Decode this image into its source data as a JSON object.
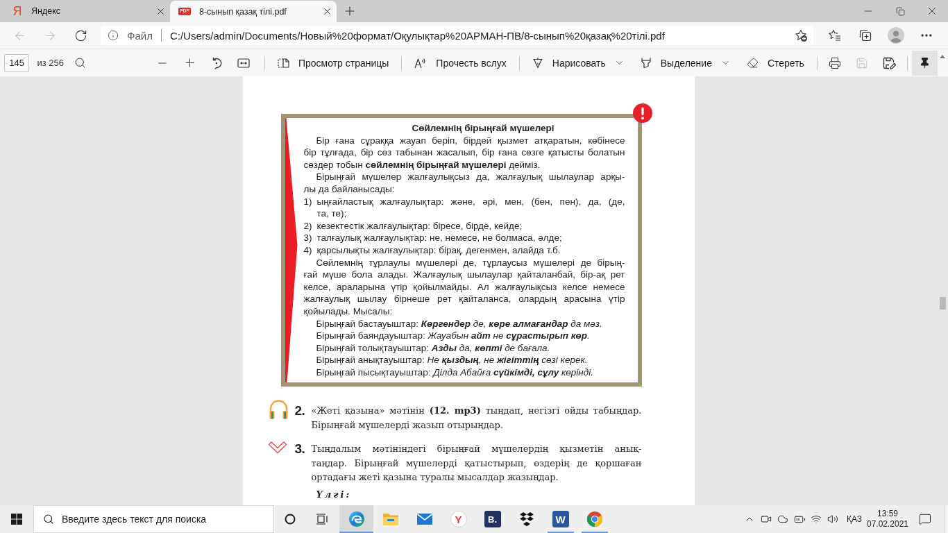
{
  "browser": {
    "tabs": [
      {
        "title": "Яндекс",
        "favicon": "Я",
        "kind": "site",
        "selected": false
      },
      {
        "title": "8-сынып қазақ тілі.pdf",
        "favicon": "PDF",
        "kind": "pdf",
        "selected": true
      }
    ],
    "nav_buttons": [
      {
        "kind": "back",
        "disabled": true
      },
      {
        "kind": "forward",
        "disabled": true
      },
      {
        "kind": "refresh",
        "disabled": false
      }
    ],
    "address_bar": {
      "scheme": "Файл",
      "url": "C:/Users/admin/Documents/Новый%20формат/Оқулықтар%20АРМАН-ПВ/8-сынып%20қазақ%20тілі.pdf"
    }
  },
  "pdf_toolbar": {
    "page": "145",
    "page_total": "из 256",
    "tools": [
      {
        "kind": "page-view",
        "label": "Просмотр страницы",
        "dropdown": false
      },
      {
        "kind": "read-aloud",
        "label": "Прочесть вслух",
        "dropdown": false
      },
      {
        "kind": "draw",
        "label": "Нарисовать",
        "dropdown": true
      },
      {
        "kind": "highlight",
        "label": "Выделение",
        "dropdown": true
      },
      {
        "kind": "erase",
        "label": "Стереть",
        "dropdown": false
      }
    ],
    "icon_buttons": [
      {
        "kind": "print",
        "disabled": false
      },
      {
        "kind": "save",
        "disabled": true
      },
      {
        "kind": "save-as",
        "disabled": false
      }
    ],
    "pinned": true
  },
  "document": {
    "info_box": {
      "title": "Сөйлемнің бірыңғай мүшелері",
      "blocks": [
        {
          "kind": "paragraph",
          "lines": [
            "Бір ғана сұраққа жауап беріп, бірдей қызмет атқаратын, көбінесе",
            "бір тұлғада, бір сөз табынан жасалып, бір ғана сөзге қатысты болатын",
            "сөздер тобын **сөйлемнің бірыңғай мүшелері** дейміз."
          ]
        },
        {
          "kind": "paragraph",
          "lines": [
            "Бірыңғай мүшелер жалғаулықсыз да, жалғаулық шылаулар арқы-",
            "лы да байланысады:"
          ]
        },
        {
          "kind": "item",
          "number": "1)",
          "lines": [
            "ыңғайластық жалғаулықтар: және, әрі, мен, (бен, пен), да, (де,",
            "та, те);"
          ]
        },
        {
          "kind": "item",
          "number": "2)",
          "lines": [
            "кезектестік жалғаулықтар: біресе, бірде, кейде;"
          ]
        },
        {
          "kind": "item",
          "number": "3)",
          "lines": [
            "талғаулық жалғаулықтар: не, немесе, не болмаса, әлде;"
          ]
        },
        {
          "kind": "item",
          "number": "4)",
          "lines": [
            "қарсылықты жалғаулықтар: бірақ, дегенмен, алайда т.б."
          ]
        },
        {
          "kind": "paragraph",
          "lines": [
            "Сөйлемнің тұрлаулы мүшелері де, тұрлаусыз мүшелері де бірың-",
            "ғай мүше бола алады. Жалғаулық шылаулар қайталанбай, бір-ақ рет",
            "келсе, араларына үтір қойылмайды. Ал жалғаулықсыз келсе немесе",
            "жалғаулық шылау бірнеше рет қайталанса, олардың арасына үтір",
            "қойылады. Мысалы:"
          ]
        },
        {
          "kind": "example",
          "label": "Бірыңғай бастауыштар:",
          "example": "**Көргендер** де, **көре алмағандар** да мәз."
        },
        {
          "kind": "example",
          "label": "Бірыңғай баяндауыштар:",
          "example": "Жауабын **айт** не **сұрастырып көр**."
        },
        {
          "kind": "example",
          "label": "Бірыңғай толықтауыштар:",
          "example": "**Азды** да, **көпті** де бағала."
        },
        {
          "kind": "example",
          "label": "Бірыңғай анықтауыштар:",
          "example": "Не **қыздың**, не **жігіттің** сөзі керек."
        },
        {
          "kind": "example",
          "label": "Бірыңғай пысықтауыштар:",
          "example": "Ділда Абайға **сүйкімді, сұлу** көрінді."
        }
      ]
    },
    "exercises": [
      {
        "kind": "listening",
        "number": "2.",
        "lines": [
          "«Жеті қазына» мәтінін **(12. mp3)** тыңдап, негізгі ойды табыңдар.",
          "Бірыңғай мүшелерді жазып отырыңдар."
        ]
      },
      {
        "kind": "writing",
        "number": "3.",
        "lines": [
          "Тыңдалым мәтініндегі бірыңғай мүшелердің қызметін анық-",
          "таңдар. Бірыңғай мүшелерді қатыстырып, өздерің де қоршаған",
          "ортадағы жеті қазына туралы мысалдар жазыңдар."
        ]
      }
    ],
    "sample_label": "Үлгі:"
  },
  "taskbar": {
    "search_placeholder": "Введите здесь текст для поиска",
    "apps": [
      {
        "kind": "edge",
        "running": true,
        "selected": true
      },
      {
        "kind": "explorer",
        "running": false,
        "selected": false
      },
      {
        "kind": "mail",
        "running": false,
        "selected": false
      },
      {
        "kind": "yandex",
        "glyph": "Y",
        "running": false,
        "selected": false
      },
      {
        "kind": "b",
        "glyph": "B.",
        "running": false,
        "selected": false
      },
      {
        "kind": "dropbox",
        "running": false,
        "selected": false
      },
      {
        "kind": "word",
        "glyph": "W",
        "running": true,
        "selected": false
      },
      {
        "kind": "chrome",
        "running": true,
        "selected": false
      }
    ],
    "language": "ҚАЗ",
    "time": "13:59",
    "date": "07.02.2021"
  }
}
